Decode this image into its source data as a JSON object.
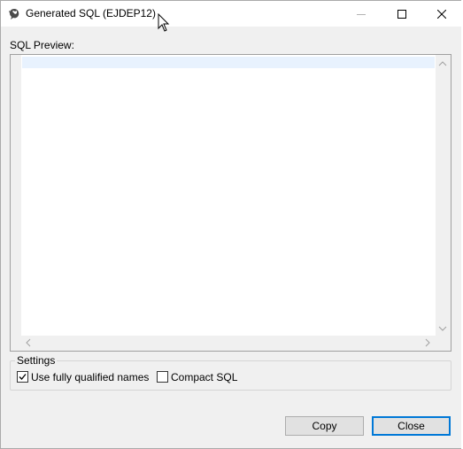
{
  "window": {
    "title": "Generated SQL (EJDEP12)",
    "controls": {
      "minimize_icon": "minimize-icon",
      "maximize_icon": "maximize-icon",
      "close_icon": "close-icon"
    }
  },
  "preview": {
    "label": "SQL Preview:",
    "content": ""
  },
  "settings": {
    "legend": "Settings",
    "fully_qualified": {
      "label": "Use fully qualified names",
      "checked": true
    },
    "compact_sql": {
      "label": "Compact SQL",
      "checked": false
    }
  },
  "buttons": {
    "copy": "Copy",
    "close": "Close"
  },
  "colors": {
    "accent": "#0078d7",
    "current_line": "#e8f2fe",
    "dialog_bg": "#f0f0f0"
  }
}
